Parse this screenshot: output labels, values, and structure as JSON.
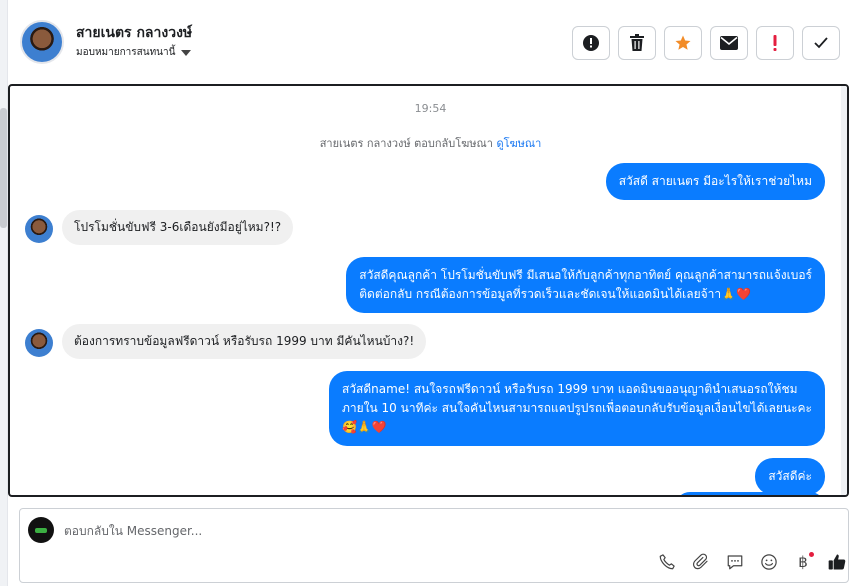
{
  "header": {
    "user_name": "สายเนตร กลางวงษ์",
    "assign_label": "มอบหมายการสนทนานี้",
    "actions": [
      {
        "icon": "exclamation-circle-icon",
        "label": "!"
      },
      {
        "icon": "trash-icon"
      },
      {
        "icon": "star-icon",
        "color": "#f28c28"
      },
      {
        "icon": "envelope-icon"
      },
      {
        "icon": "exclamation-icon",
        "label": "!",
        "color": "#e41e3f"
      },
      {
        "icon": "checkmark-icon"
      }
    ]
  },
  "conversation": {
    "timestamp": "19:54",
    "ad_reply_text": "สายเนตร กลางวงษ์ ตอบกลับโฆษณา",
    "ad_link": "ดูโฆษณา",
    "messages": [
      {
        "from": "page",
        "text": "สวัสดี สายเนตร มีอะไรให้เราช่วยไหม"
      },
      {
        "from": "user",
        "text": "โปรโมชั่นขับฟรี 3-6เดือนยังมีอยู่ไหม?!?"
      },
      {
        "from": "page",
        "lines": [
          "สวัสดีคุณลูกค้า โปรโมชั่นขับฟรี มีเสนอให้กับลูกค้าทุกอาทิตย์ คุณลูกค้าสามารถแจ้งเบอร์",
          "ติดต่อกลับ กรณีต้องการข้อมูลที่รวดเร็วและชัดเจนให้แอดมินได้เลยจ้าา🙏❤️"
        ]
      },
      {
        "from": "user",
        "text": "ต้องการทราบข้อมูลฟรีดาวน์ หรือรับรถ 1999 บาท มีคันไหนบ้าง?!"
      },
      {
        "from": "page",
        "lines": [
          "สวัสดีname! สนใจรถฟรีดาวน์ หรือรับรถ 1999 บาท แอดมินขออนุญาตินำเสนอรถให้ชม",
          "ภายใน 10 นาทีค่ะ สนใจคันไหนสามารถแคปรูปรถเพื่อตอบกลับรับข้อมูลเงื่อนไขได้เลยนะคะ",
          "🥰🙏❤️"
        ]
      },
      {
        "from": "page",
        "text": "สวัสดีค่ะ"
      }
    ]
  },
  "composer": {
    "placeholder": "ตอบกลับใน Messenger...",
    "tools": [
      "phone-icon",
      "paperclip-icon",
      "saved-reply-icon",
      "emoji-icon",
      "baht-payment-icon",
      "like-icon"
    ],
    "baht_symbol": "฿"
  },
  "colors": {
    "outgoing_bubble": "#0a7cff",
    "incoming_bubble": "#f0f0f0",
    "link": "#1877f2"
  }
}
